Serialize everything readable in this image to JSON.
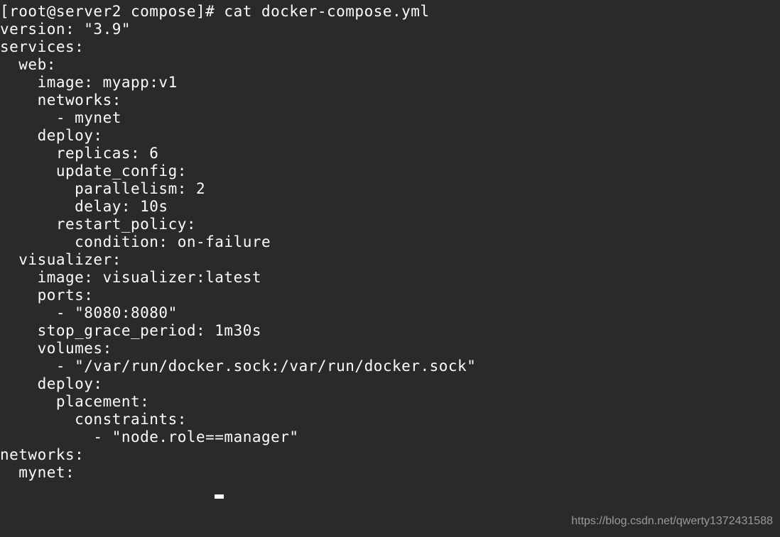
{
  "terminal": {
    "lines": [
      "[root@server2 compose]# cat docker-compose.yml",
      "version: \"3.9\"",
      "services:",
      "",
      "  web:",
      "    image: myapp:v1",
      "    networks:",
      "      - mynet",
      "    deploy:",
      "      replicas: 6",
      "      update_config:",
      "        parallelism: 2",
      "        delay: 10s",
      "      restart_policy:",
      "        condition: on-failure",
      "",
      "  visualizer:",
      "    image: visualizer:latest",
      "    ports:",
      "      - \"8080:8080\"",
      "    stop_grace_period: 1m30s",
      "    volumes:",
      "      - \"/var/run/docker.sock:/var/run/docker.sock\"",
      "    deploy:",
      "      placement:",
      "        constraints:",
      "          - \"node.role==manager\"",
      "",
      "networks:",
      "  mynet:"
    ]
  },
  "watermark": "https://blog.csdn.net/qwerty1372431588"
}
